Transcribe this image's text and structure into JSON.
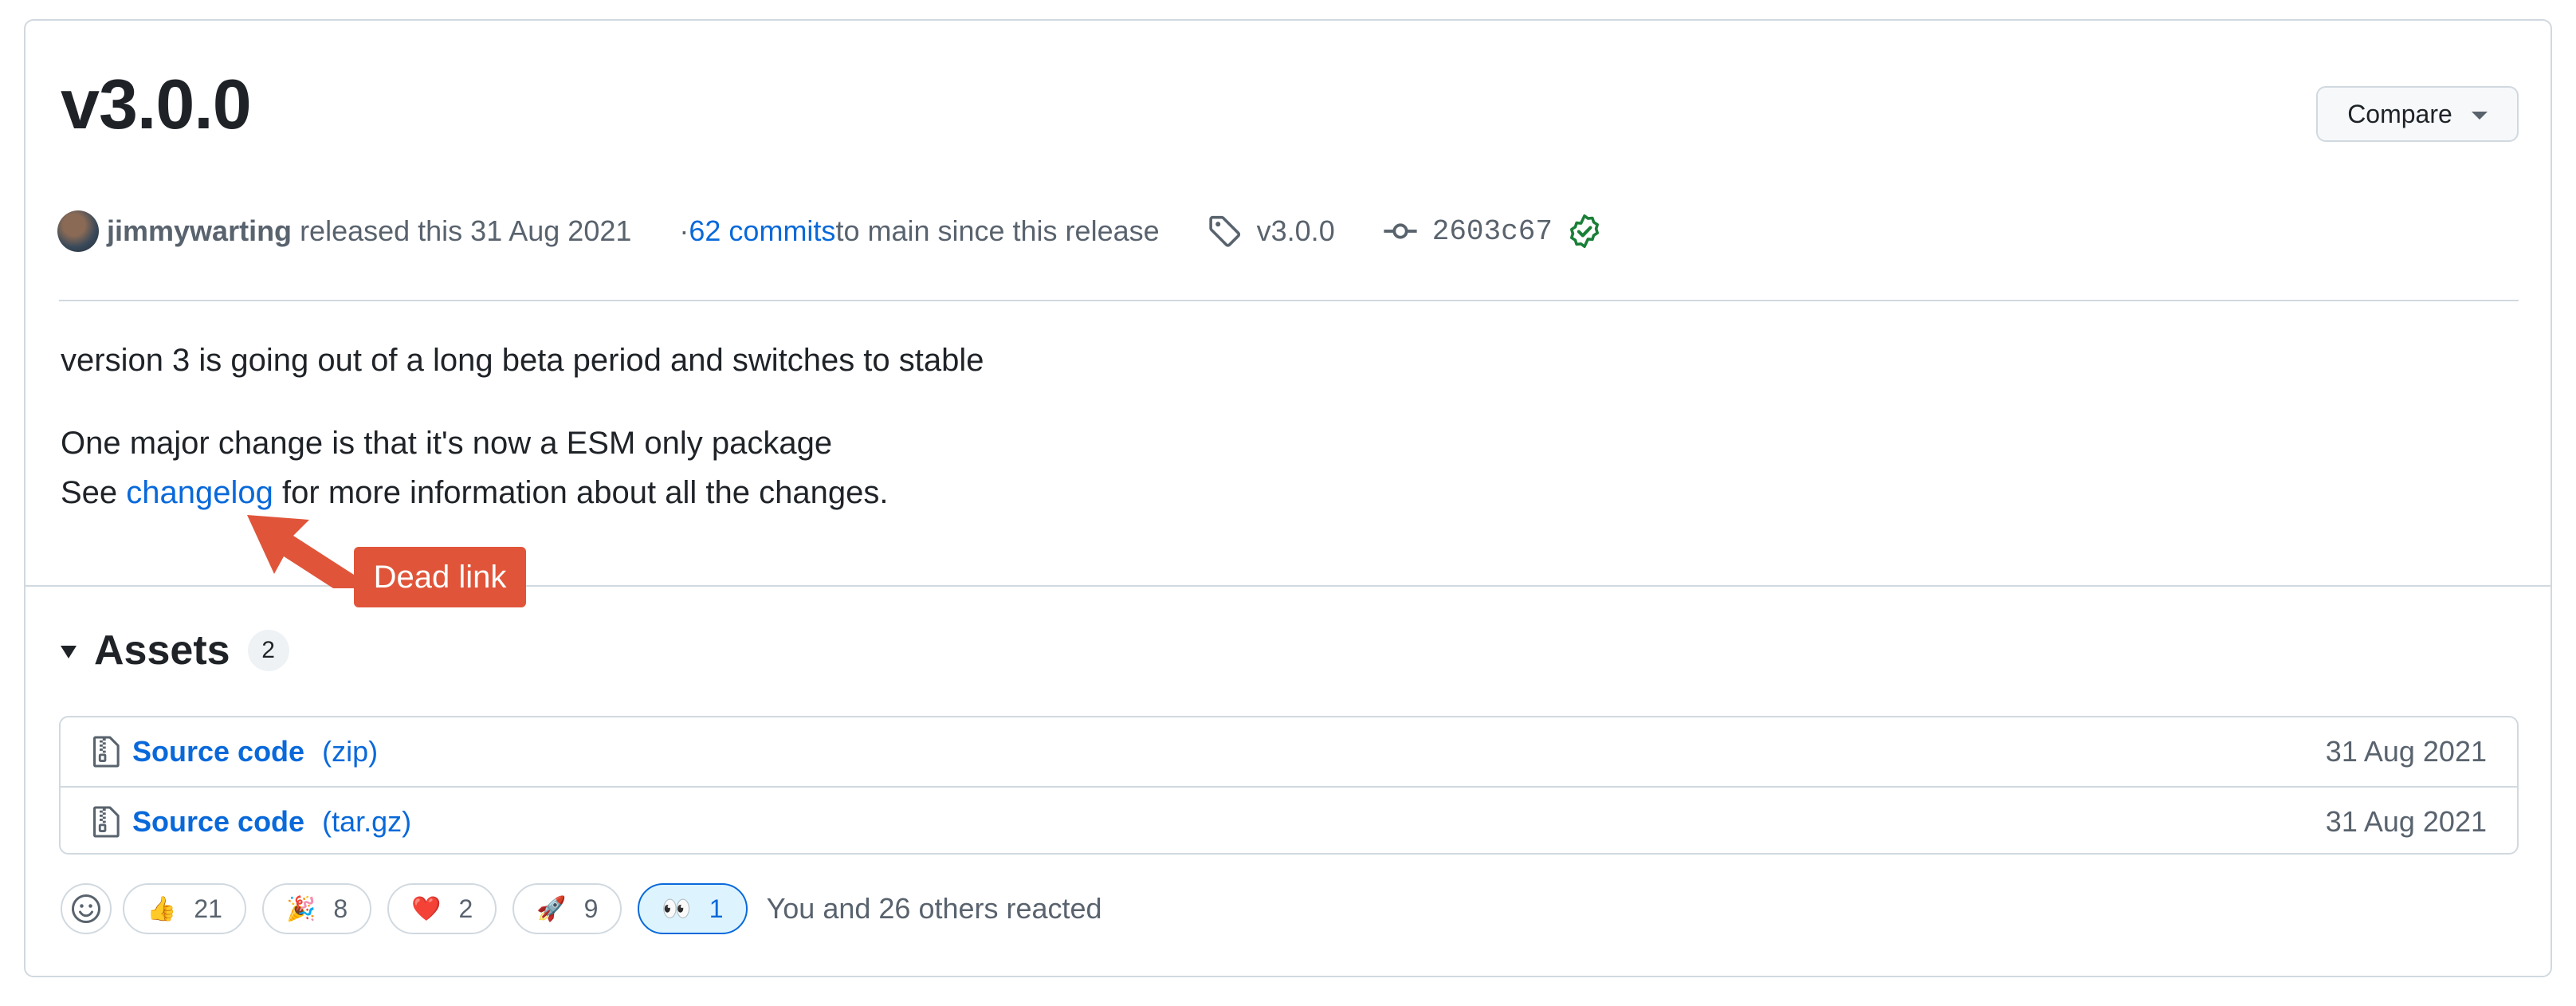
{
  "release": {
    "title": "v3.0.0",
    "compare_label": "Compare",
    "author": "jimmywarting",
    "released_text": "released this 31 Aug 2021",
    "commits_prefix": "· ",
    "commits_link": "62 commits",
    "commits_suffix": " to main since this release",
    "tag": "v3.0.0",
    "commit_sha": "2603c67"
  },
  "body": {
    "line1": "version 3 is going out of a long beta period and switches to stable",
    "line2": "One major change is that it's now a ESM only package",
    "line3_prefix": "See ",
    "line3_link": "changelog",
    "line3_suffix": " for more information about all the changes."
  },
  "annotation": {
    "label": "Dead link",
    "color": "#e0553a"
  },
  "assets": {
    "title": "Assets",
    "count": "2",
    "items": [
      {
        "name": "Source code",
        "ext": "(zip)",
        "date": "31 Aug 2021"
      },
      {
        "name": "Source code",
        "ext": "(tar.gz)",
        "date": "31 Aug 2021"
      }
    ]
  },
  "reactions": {
    "items": [
      {
        "emoji": "👍",
        "count": "21"
      },
      {
        "emoji": "🎉",
        "count": "8"
      },
      {
        "emoji": "❤️",
        "count": "2"
      },
      {
        "emoji": "🚀",
        "count": "9"
      },
      {
        "emoji": "👀",
        "count": "1"
      }
    ],
    "summary": "You and 26 others reacted"
  },
  "colors": {
    "link": "#0969da",
    "border": "#d1d9e0",
    "verified": "#1a7f37"
  }
}
